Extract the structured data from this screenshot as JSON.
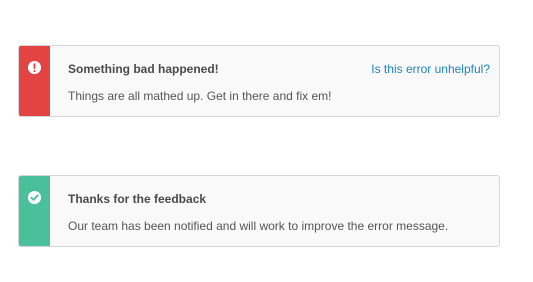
{
  "alerts": {
    "error": {
      "title": "Something bad happened!",
      "message": "Things are all mathed up. Get in there and fix em!",
      "link": "Is this error unhelpful?",
      "icon": "exclamation-circle-icon",
      "color": "#e34343"
    },
    "success": {
      "title": "Thanks for the feedback",
      "message": "Our team has been notified and will work to improve the error message.",
      "icon": "check-circle-icon",
      "color": "#49c09a"
    }
  },
  "colors": {
    "background": "#f9f9f9",
    "border": "#d6d6d6",
    "link": "#1f84c2"
  }
}
